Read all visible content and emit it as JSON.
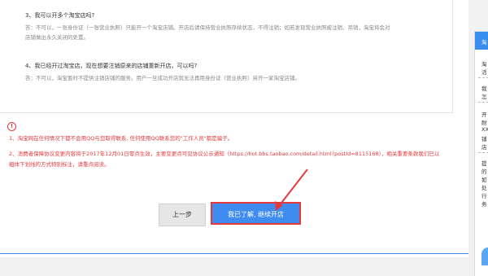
{
  "faq": {
    "q3": "3、我可以开多个淘宝店吗?",
    "a3_line1": "答：不可以，一张身份证（一张营业执照）只能开一个淘宝店铺。开店后请保持营业执照存续状态，不得注销；如若发现营业执照被注销、吊销，淘宝将会对",
    "a3_line2": "店铺做出永久关闭的处置。",
    "q4": "4、我已经开过淘宝店，现在想要注销原来的店铺重新开店，可以吗?",
    "a4": "答：不可以，淘宝暂时不提供注销店铺的服务。用户一旦成功开店就无法再用身份证（营业执照）另开一家淘宝店铺。"
  },
  "notice": {
    "icon": "!",
    "line1": "1、淘宝网在任何情况下都不会用QQ与您取得联系, 任何使用QQ联系您的\"工作人员\"都是骗子。",
    "line2a": "2、消费者保障协议变更内容将于2017年12月01日零点生效，主要变更点可见协议公示通知（",
    "link": "https://hot.bbs.taobao.com/detail.html?postId=8115168",
    "line2b": "），相关重要条款我们已以",
    "line3": "粗体下划线的方式特别标注，请重点阅读。"
  },
  "buttons": {
    "prev": "上一步",
    "next": "我已了解, 继续开店"
  },
  "sidebar": {
    "head": "淘",
    "items": [
      "淘",
      "活",
      "我",
      "怎",
      "开",
      "耐",
      "XX",
      "铺",
      "店",
      "提",
      "的",
      "如",
      "处",
      "行",
      "务"
    ]
  },
  "colors": {
    "accent": "#3f8cf0",
    "warning": "#e4393c"
  }
}
